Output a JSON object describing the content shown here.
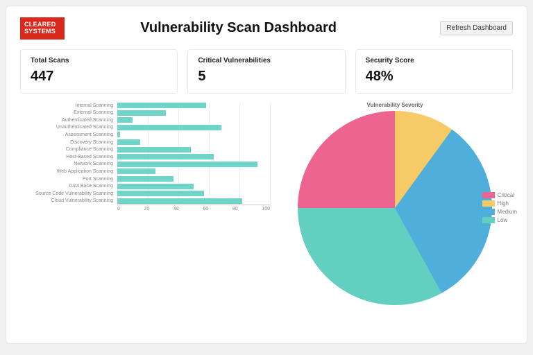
{
  "logo": {
    "line1": "CLEARED",
    "line2": "SYSTEMS"
  },
  "header": {
    "title": "Vulnerability Scan Dashboard",
    "refresh_label": "Refresh Dashboard"
  },
  "cards": {
    "total_scans": {
      "label": "Total Scans",
      "value": "447"
    },
    "critical": {
      "label": "Critical Vulnerabilities",
      "value": "5"
    },
    "score": {
      "label": "Security Score",
      "value": "48%"
    }
  },
  "chart_data": [
    {
      "type": "bar",
      "orientation": "horizontal",
      "categories": [
        "Internal Scanning",
        "External Scanning",
        "Authenticated Scanning",
        "Unauthenticated Scanning",
        "Assessment Scanning",
        "Discovery Scanning",
        "Compliance Scanning",
        "Host-Based Scanning",
        "Network Scanning",
        "Web Application Scanning",
        "Port Scanning",
        "Data Base Scanning",
        "Source Code Vulnerability Scanning",
        "Cloud Vulnerability Scanning"
      ],
      "values": [
        58,
        32,
        10,
        68,
        2,
        15,
        48,
        63,
        92,
        25,
        37,
        50,
        57,
        82
      ],
      "xlim": [
        0,
        100
      ],
      "xticks": [
        0,
        20,
        40,
        60,
        80,
        100
      ],
      "bar_color": "#6fd5c9"
    },
    {
      "type": "pie",
      "title": "Vulnerability Severity",
      "series": [
        {
          "name": "Critical",
          "value": 25,
          "color": "#ee6491"
        },
        {
          "name": "High",
          "value": 10,
          "color": "#f6ca66"
        },
        {
          "name": "Medium",
          "value": 32,
          "color": "#4faeda"
        },
        {
          "name": "Low",
          "value": 33,
          "color": "#63cfc1"
        }
      ]
    }
  ]
}
